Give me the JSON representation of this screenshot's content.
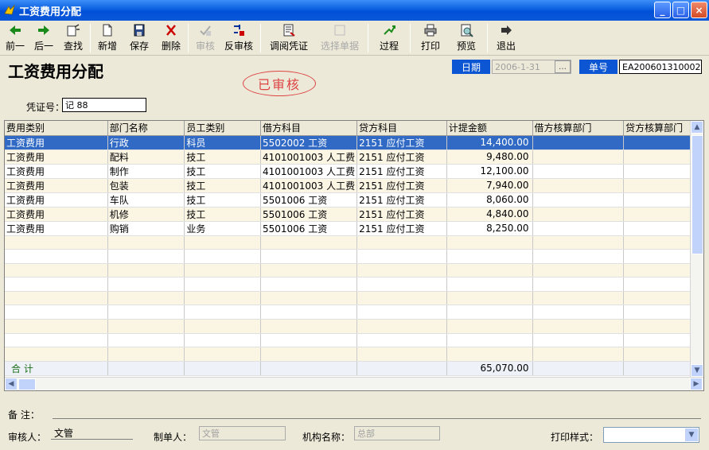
{
  "window": {
    "title": "工资费用分配",
    "buttons": {
      "minimize": "_",
      "maximize": "□",
      "close": "×"
    }
  },
  "toolbar": [
    {
      "id": "prev",
      "label": "前一",
      "icon": "arrow-left-icon",
      "enabled": true
    },
    {
      "id": "next",
      "label": "后一",
      "icon": "arrow-right-icon",
      "enabled": true
    },
    {
      "id": "find",
      "label": "查找",
      "icon": "find-icon",
      "enabled": true
    },
    {
      "id": "new",
      "label": "新增",
      "icon": "new-doc-icon",
      "enabled": true
    },
    {
      "id": "save",
      "label": "保存",
      "icon": "save-icon",
      "enabled": true
    },
    {
      "id": "delete",
      "label": "删除",
      "icon": "delete-icon",
      "enabled": true
    },
    {
      "id": "audit",
      "label": "审核",
      "icon": "audit-icon",
      "enabled": false
    },
    {
      "id": "unaudit",
      "label": "反审核",
      "icon": "unaudit-icon",
      "enabled": true
    },
    {
      "id": "voucher",
      "label": "调阅凭证",
      "icon": "voucher-icon",
      "enabled": true
    },
    {
      "id": "select",
      "label": "选择单据",
      "icon": "select-icon",
      "enabled": false
    },
    {
      "id": "process",
      "label": "过程",
      "icon": "process-icon",
      "enabled": true
    },
    {
      "id": "print",
      "label": "打印",
      "icon": "printer-icon",
      "enabled": true
    },
    {
      "id": "preview",
      "label": "预览",
      "icon": "preview-icon",
      "enabled": true
    },
    {
      "id": "exit",
      "label": "退出",
      "icon": "exit-icon",
      "enabled": true
    }
  ],
  "header": {
    "title": "工资费用分配",
    "stamp": "已审核",
    "date_label": "日期",
    "date_value": "2006-1-31",
    "date_button": "…",
    "number_label": "单号",
    "number_value": "EA200601310002",
    "voucher_label": "凭证号：",
    "voucher_value": "记 88"
  },
  "grid": {
    "columns": [
      "费用类别",
      "部门名称",
      "员工类别",
      "借方科目",
      "贷方科目",
      "计提金额",
      "借方核算部门",
      "贷方核算部门"
    ],
    "rows": [
      [
        "工资费用",
        "行政",
        "科员",
        "5502002 工资",
        "2151 应付工资",
        "14,400.00",
        "",
        ""
      ],
      [
        "工资费用",
        "配料",
        "技工",
        "4101001003 人工费",
        "2151 应付工资",
        "9,480.00",
        "",
        ""
      ],
      [
        "工资费用",
        "制作",
        "技工",
        "4101001003 人工费",
        "2151 应付工资",
        "12,100.00",
        "",
        ""
      ],
      [
        "工资费用",
        "包装",
        "技工",
        "4101001003 人工费",
        "2151 应付工资",
        "7,940.00",
        "",
        ""
      ],
      [
        "工资费用",
        "车队",
        "技工",
        "5501006 工资",
        "2151 应付工资",
        "8,060.00",
        "",
        ""
      ],
      [
        "工资费用",
        "机修",
        "技工",
        "5501006 工资",
        "2151 应付工资",
        "4,840.00",
        "",
        ""
      ],
      [
        "工资费用",
        "购销",
        "业务",
        "5501006 工资",
        "2151 应付工资",
        "8,250.00",
        "",
        ""
      ]
    ],
    "empty_rows": 9,
    "total_label": "合 计",
    "total_amount": "65,070.00"
  },
  "footer": {
    "remark_label": "备 注：",
    "auditor_label": "审核人：",
    "auditor_value": "文管",
    "maker_label": "制单人：",
    "maker_value": "文管",
    "org_label": "机构名称：",
    "org_value": "总部",
    "print_style_label": "打印样式：",
    "print_style_value": ""
  }
}
